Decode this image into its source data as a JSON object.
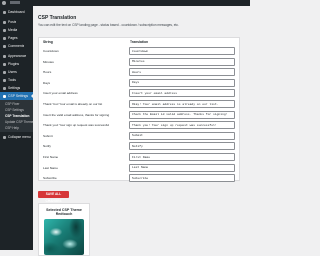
{
  "sidebar": {
    "items": [
      {
        "label": "Dashboard",
        "icon": "dashboard-icon"
      },
      {
        "label": "Posts",
        "icon": "pin-icon"
      },
      {
        "label": "Media",
        "icon": "media-icon"
      },
      {
        "label": "Pages",
        "icon": "page-icon"
      },
      {
        "label": "Comments",
        "icon": "comment-icon"
      },
      {
        "label": "Appearance",
        "icon": "brush-icon"
      },
      {
        "label": "Plugins",
        "icon": "plugin-icon"
      },
      {
        "label": "Users",
        "icon": "users-icon"
      },
      {
        "label": "Tools",
        "icon": "wrench-icon"
      },
      {
        "label": "Settings",
        "icon": "settings-icon"
      }
    ],
    "active": {
      "label": "CSP Settings",
      "icon": "shield-icon"
    },
    "submenu": [
      "CSP Fixer",
      "CSP Settings",
      "CSP Translation",
      "Update CSP Theme",
      "CSP Help"
    ],
    "submenu_current_index": 2,
    "collapse_label": "Collapse menu"
  },
  "page": {
    "title": "CSP Translation",
    "description": "You can edit the text on CSP landing page - status based - countdown / subscription messages, etc.",
    "columns": {
      "left": "String",
      "right": "Translation"
    },
    "rows": [
      {
        "source": "Countdown",
        "translation": "Countdown"
      },
      {
        "source": "Minutes",
        "translation": "Minutes"
      },
      {
        "source": "Hours",
        "translation": "Hours"
      },
      {
        "source": "Days",
        "translation": "Days"
      },
      {
        "source": "Insert your email address",
        "translation": "Insert your email address"
      },
      {
        "source": "Thank You! Your email is already on our list",
        "translation": "Okay! Your email address is already on our list."
      },
      {
        "source": "Insert the valid email address, thanks for signing",
        "translation": "Check the Email id valid address. Thanks for signing!"
      },
      {
        "source": "Thank you! Your sign up request was successful",
        "translation": "Thank you! Your sign up request was successful!"
      },
      {
        "source": "Submit",
        "translation": "Submit"
      },
      {
        "source": "Notify",
        "translation": "Notify"
      },
      {
        "source": "First Name",
        "translation": "First Name"
      },
      {
        "source": "Last Name",
        "translation": "Last Name"
      },
      {
        "source": "Subscribe",
        "translation": "Subscribe"
      }
    ],
    "save_label": "SAVE ALL CHANGES"
  },
  "promo": {
    "title": "Selected CSP Theme Redtouch"
  },
  "colors": {
    "sidebar_bg": "#1d2327",
    "active_menu": "#2271b1",
    "save_button": "#d63638",
    "page_bg": "#f0f0f1"
  }
}
